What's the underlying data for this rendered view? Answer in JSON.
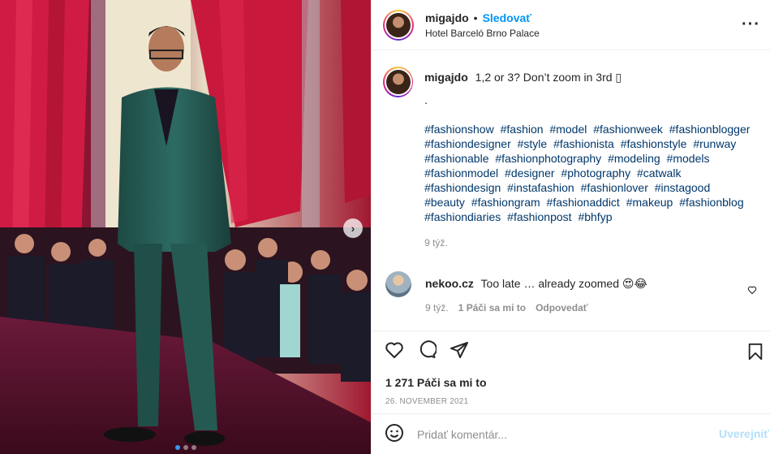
{
  "header": {
    "username": "migajdo",
    "separator": "•",
    "follow_label": "Sledovať",
    "location": "Hotel Barceló Brno Palace",
    "more_icon": "more-horizontal-icon"
  },
  "caption": {
    "username": "migajdo",
    "text": "1,2 or 3? Don’t zoom in 3rd ▯",
    "dot": ".",
    "hashtags": [
      "#fashionshow",
      "#fashion",
      "#model",
      "#fashionweek",
      "#fashionblogger",
      "#fashiondesigner",
      "#style",
      "#fashionista",
      "#fashionstyle",
      "#runway",
      "#fashionable",
      "#fashionphotography",
      "#modeling",
      "#models",
      "#fashionmodel",
      "#designer",
      "#photography",
      "#catwalk",
      "#fashiondesign",
      "#instafashion",
      "#fashionlover",
      "#instagood",
      "#beauty",
      "#fashiongram",
      "#fashionaddict",
      "#makeup",
      "#fashionblog",
      "#fashiondiaries",
      "#fashionpost",
      "#bhfyp"
    ],
    "time": "9 týž."
  },
  "comment": {
    "username": "nekoo.cz",
    "text": "Too late … already zoomed 😍😂",
    "time": "9 týž.",
    "likes": "1 Páči sa mi to",
    "reply": "Odpovedať"
  },
  "actions": {
    "like_icon": "heart-icon",
    "comment_icon": "comment-icon",
    "share_icon": "share-icon",
    "save_icon": "bookmark-icon"
  },
  "likes_text": "1 271 Páči sa mi to",
  "date": "26. NOVEMBER 2021",
  "add_comment": {
    "placeholder": "Pridať komentár...",
    "post_label": "Uverejniť",
    "emoji_icon": "emoji-icon"
  },
  "carousel": {
    "next_icon": "chevron-right-icon",
    "slides_total": 3,
    "active_slide": 1
  },
  "colors": {
    "link_blue": "#0095f6",
    "hashtag": "#00376b",
    "muted": "#8e8e8e",
    "post_disabled": "#b2dffc"
  }
}
